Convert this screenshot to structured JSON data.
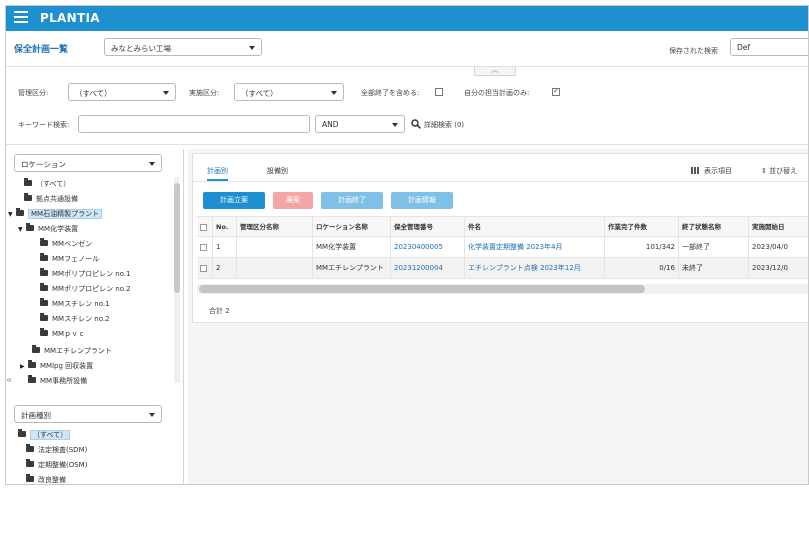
{
  "header": {
    "app_title": "PLANTIA"
  },
  "page": {
    "title": "保全計画一覧",
    "plant_select": "みなとみらい工場",
    "saved_search_label": "保存された検索",
    "saved_search_value": "Def"
  },
  "filters": {
    "mgmt_label": "管理区分:",
    "mgmt_value": "（すべて）",
    "exec_label": "実施区分:",
    "exec_value": "（すべて）",
    "include_done_label": "全部終了を含める:",
    "include_done_checked": false,
    "mine_only_label": "自分の担当計画のみ:",
    "mine_only_checked": true,
    "keyword_label": "キーワード検索:",
    "keyword_value": "",
    "operator_value": "AND",
    "advanced_label": "詳細検索 (0)"
  },
  "left_panel": {
    "location_select": "ロケーション",
    "tree": [
      {
        "label": "（すべて）",
        "level": 0,
        "arrow": ""
      },
      {
        "label": "拠点共通設備",
        "level": 0,
        "arrow": ""
      },
      {
        "label": "MM石油精製プラント",
        "level": 0,
        "arrow": "▼",
        "selected": true
      },
      {
        "label": "MM化学装置",
        "level": 1,
        "arrow": "▼"
      },
      {
        "label": "MMベンゼン",
        "level": 2,
        "arrow": ""
      },
      {
        "label": "MMフェノール",
        "level": 2,
        "arrow": ""
      },
      {
        "label": "MMポリプロピレン no.1",
        "level": 2,
        "arrow": ""
      },
      {
        "label": "MMポリプロピレン no.2",
        "level": 2,
        "arrow": ""
      },
      {
        "label": "MMスチレン no.1",
        "level": 2,
        "arrow": ""
      },
      {
        "label": "MMスチレン no.2",
        "level": 2,
        "arrow": ""
      },
      {
        "label": "MMｐｖｃ",
        "level": 2,
        "arrow": ""
      },
      {
        "label": "MMエチレンプラント",
        "level": 1,
        "arrow": ""
      },
      {
        "label": "MMlpg 回収装置",
        "level": 1,
        "arrow": "▶"
      },
      {
        "label": "MM事務所設備",
        "level": 1,
        "arrow": ""
      }
    ],
    "plan_type_select": "計画種別",
    "plan_types": [
      {
        "label": "（すべて）",
        "selected": true
      },
      {
        "label": "法定検査(SDM)",
        "selected": false
      },
      {
        "label": "定期整備(OSM)",
        "selected": false
      },
      {
        "label": "改良整備",
        "selected": false
      }
    ]
  },
  "main": {
    "tabs": [
      {
        "label": "計画別",
        "active": true
      },
      {
        "label": "設備別",
        "active": false
      }
    ],
    "display_items_label": "表示項目",
    "sort_label": "並び替え",
    "buttons": {
      "create": "計画立案",
      "delete": "廃案",
      "finish": "計画終了",
      "info": "計画情報"
    },
    "colors": {
      "primary": "#1e8fcf",
      "danger_light": "#f4a6a6",
      "primary_light": "#7fc1e6",
      "header_bg": "#1e8fcf"
    },
    "columns": [
      "",
      "No.",
      "管理区分名称",
      "ロケーション名称",
      "保全管理番号",
      "件名",
      "作業完了件数",
      "終了状態名称",
      "実施開始日"
    ],
    "rows": [
      {
        "no": "1",
        "mgmt": "",
        "location": "MM化学装置",
        "number": "20230400005",
        "subject": "化学装置定期整備 2023年4月",
        "done": "101/342",
        "status": "一部終了",
        "start": "2023/04/0"
      },
      {
        "no": "2",
        "mgmt": "",
        "location": "MMエチレンプラント",
        "number": "20231200004",
        "subject": "エチレンプラント点検 2023年12月",
        "done": "0/16",
        "status": "未終了",
        "start": "2023/12/0"
      }
    ],
    "total_label": "合計 2"
  }
}
